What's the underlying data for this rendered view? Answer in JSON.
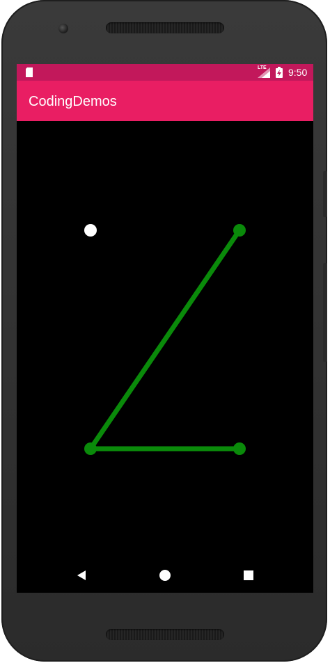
{
  "status_bar": {
    "time": "9:50",
    "network": "LTE",
    "icons": [
      "sd-card-icon",
      "lte-signal-icon",
      "battery-charging-icon"
    ]
  },
  "app_bar": {
    "title": "CodingDemos"
  },
  "pattern": {
    "nodes": [
      {
        "id": "top-left",
        "selected": false
      },
      {
        "id": "top-right",
        "selected": true
      },
      {
        "id": "bottom-left",
        "selected": true
      },
      {
        "id": "bottom-right",
        "selected": true
      }
    ],
    "path": [
      "top-right",
      "bottom-left",
      "bottom-right"
    ]
  },
  "nav_bar": {
    "buttons": [
      "back-icon",
      "home-icon",
      "recents-icon"
    ]
  },
  "colors": {
    "status_bar": "#c2185b",
    "app_bar": "#e91e63",
    "pattern_line": "#0a8a0a",
    "node_idle": "#ffffff"
  }
}
